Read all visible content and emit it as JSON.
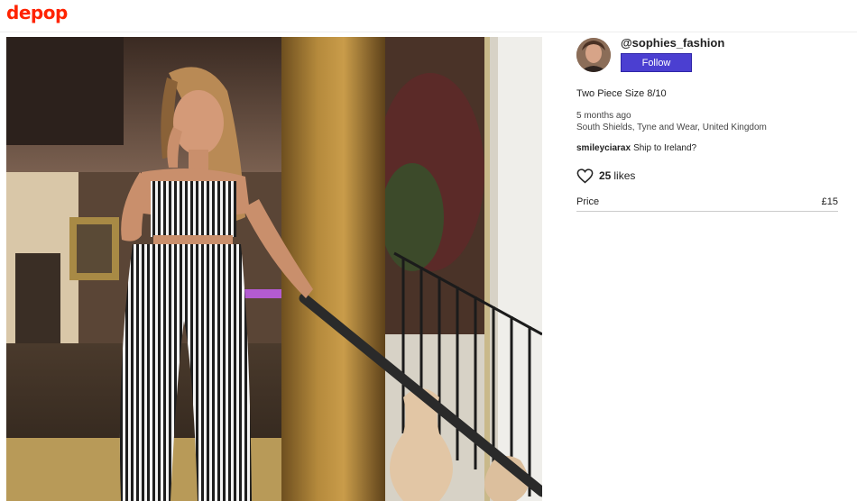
{
  "header": {
    "logo_text": "depop"
  },
  "seller": {
    "username": "@sophies_fashion",
    "follow_label": "Follow"
  },
  "listing": {
    "title": "Two Piece Size 8/10",
    "posted": "5 months ago",
    "location": "South Shields, Tyne and Wear, United Kingdom"
  },
  "comment": {
    "user": "smileyciarax",
    "text": "Ship to Ireland?"
  },
  "likes": {
    "count": "25",
    "label": "likes"
  },
  "price": {
    "label": "Price",
    "value": "£15"
  },
  "icons": {
    "heart": "heart-icon",
    "avatar": "avatar-image"
  },
  "colors": {
    "brand": "#ff2300",
    "follow_button": "#4b3fd1"
  }
}
